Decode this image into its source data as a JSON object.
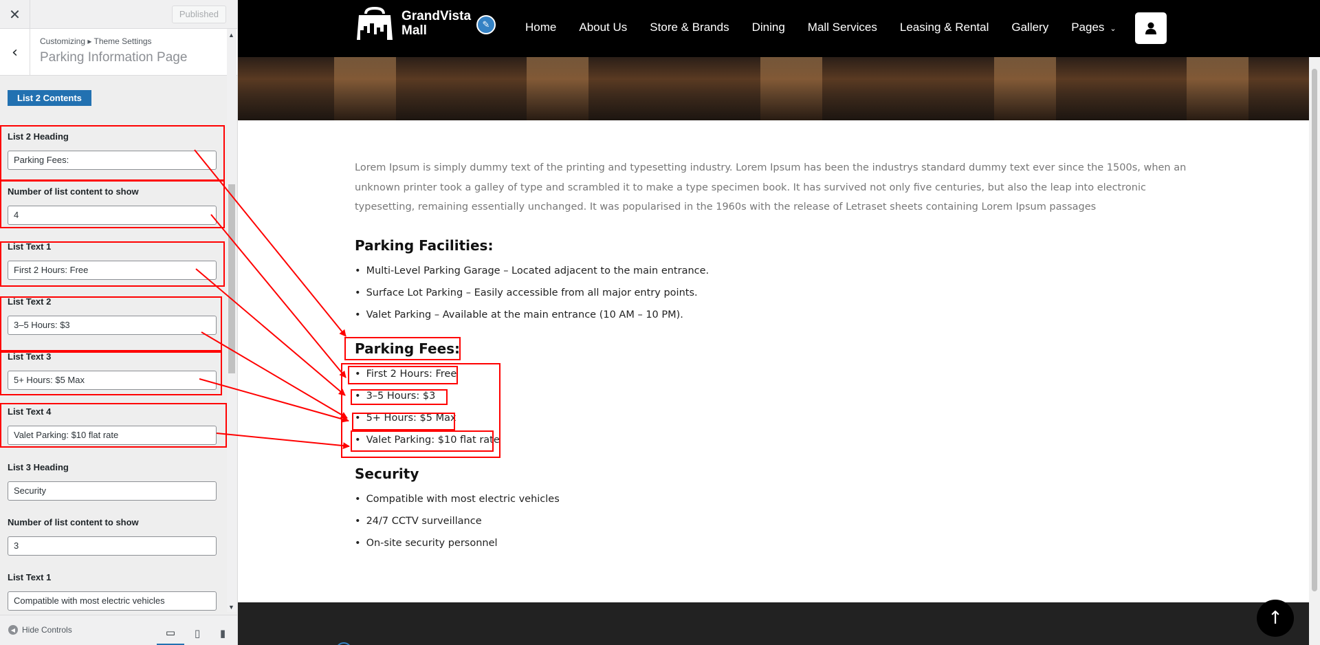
{
  "customizer": {
    "close_icon": "close-icon",
    "published_label": "Published",
    "breadcrumb": "Customizing ▸ Theme Settings",
    "section_title": "Parking Information Page",
    "section_button": "List 2 Contents",
    "fields": [
      {
        "label": "List 2 Heading",
        "value": "Parking Fees:"
      },
      {
        "label": "Number of list content to show",
        "value": "4"
      },
      {
        "label": "List Text 1",
        "value": "First 2 Hours: Free"
      },
      {
        "label": "List Text 2",
        "value": "3–5 Hours: $3"
      },
      {
        "label": "List Text 3",
        "value": "5+ Hours: $5 Max"
      },
      {
        "label": "List Text 4",
        "value": "Valet Parking: $10 flat rate"
      },
      {
        "label": "List 3 Heading",
        "value": "Security"
      },
      {
        "label": "Number of list content to show",
        "value": "3"
      },
      {
        "label": "List Text 1",
        "value": "Compatible with most electric vehicles"
      }
    ],
    "hide_controls": "Hide Controls"
  },
  "site": {
    "logo_line1": "GrandVista",
    "logo_line2": "Mall",
    "menu": [
      "Home",
      "About Us",
      "Store & Brands",
      "Dining",
      "Mall Services",
      "Leasing & Rental",
      "Gallery",
      "Pages"
    ]
  },
  "content": {
    "intro": "Lorem Ipsum is simply dummy text of the printing and typesetting industry. Lorem Ipsum has been the industrys standard dummy text ever since the 1500s, when an unknown printer took a galley of type and scrambled it to make a type specimen book. It has survived not only five centuries, but also the leap into electronic typesetting, remaining essentially unchanged. It was popularised in the 1960s with the release of Letraset sheets containing Lorem Ipsum passages",
    "list1_heading": "Parking Facilities:",
    "list1": [
      "Multi-Level Parking Garage – Located adjacent to the main entrance.",
      "Surface Lot Parking – Easily accessible from all major entry points.",
      "Valet Parking – Available at the main entrance (10 AM – 10 PM)."
    ],
    "list2_heading": "Parking Fees:",
    "list2": [
      "First 2 Hours: Free",
      "3–5 Hours: $3",
      "5+ Hours: $5 Max",
      "Valet Parking: $10 flat rate"
    ],
    "list3_heading": "Security",
    "list3": [
      "Compatible with most electric vehicles",
      "24/7 CCTV surveillance",
      "On-site security personnel"
    ]
  },
  "colors": {
    "accent": "#2271b1",
    "annotation": "#ff0000",
    "nav_bg": "#000000"
  }
}
